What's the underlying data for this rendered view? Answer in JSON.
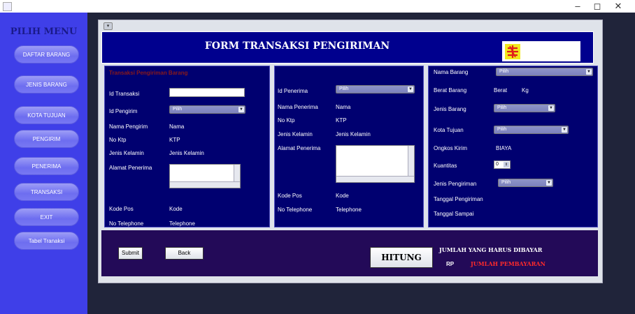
{
  "window": {
    "minimize": "–",
    "maximize": "◻",
    "close": "✕"
  },
  "sidebar": {
    "title": "PILIH MENU",
    "items": [
      {
        "label": "DAFTAR BARANG"
      },
      {
        "label": "JENIS BARANG"
      },
      {
        "label": "KOTA TUJUAN"
      },
      {
        "label": "PENGIRIM"
      },
      {
        "label": "PENERIMA"
      },
      {
        "label": "TRANSAKSI"
      },
      {
        "label": "EXIT"
      },
      {
        "label": "Tabel Tranaksi"
      }
    ]
  },
  "header": {
    "title": "FORM TRANSAKSI PENGIRIMAN"
  },
  "left_panel": {
    "title": "Transaksi Pengiriman Barang",
    "id_transaksi_label": "Id Transaksi",
    "id_transaksi_value": "",
    "id_pengirim_label": "Id Pengirim",
    "id_pengirim_value": "Pilih",
    "nama_pengirim_label": "Nama Pengirim",
    "nama_pengirim_value": "Nama",
    "no_ktp_label": "No Ktp",
    "no_ktp_value": "KTP",
    "jenis_kelamin_label": "Jenis Kelamin",
    "jenis_kelamin_value": "Jenis Kelamin",
    "alamat_label": "Alamat Penerima",
    "kode_pos_label": "Kode Pos",
    "kode_pos_value": "Kode",
    "telephone_label": "No Telephone",
    "telephone_value": "Telephone"
  },
  "mid_panel": {
    "id_penerima_label": "Id Penerima",
    "id_penerima_value": "Pilih",
    "nama_penerima_label": "Nama Penerima",
    "nama_penerima_value": "Nama",
    "no_ktp_label": "No Ktp",
    "no_ktp_value": "KTP",
    "jenis_kelamin_label": "Jenis Kelamin",
    "jenis_kelamin_value": "Jenis Kelamin",
    "alamat_label": "Alamat Penerima",
    "kode_pos_label": "Kode Pos",
    "kode_pos_value": "Kode",
    "telephone_label": "No Telephone",
    "telephone_value": "Telephone"
  },
  "right_panel": {
    "nama_barang_label": "Nama Barang",
    "nama_barang_value": "Pilih",
    "berat_label": "Berat Barang",
    "berat_value": "Berat",
    "berat_unit": "Kg",
    "jenis_barang_label": "Jenis Barang",
    "jenis_barang_value": "Pilih",
    "kota_tujuan_label": "Kota Tujuan",
    "kota_tujuan_value": "Pilih",
    "ongkos_label": "Ongkos Kirim",
    "ongkos_value": "BIAYA",
    "kuantitas_label": "Kuantitas",
    "kuantitas_value": "0",
    "jenis_pengiriman_label": "Jenis Pengiriman",
    "jenis_pengiriman_value": "Pilih",
    "tanggal_pengiriman_label": "Tanggal Pengiriman",
    "tanggal_sampai_label": "Tanggal Sampai"
  },
  "bottom": {
    "submit_label": "Submit",
    "back_label": "Back",
    "hitung_label": "HITUNG",
    "total_title": "JUMLAH YANG HARUS DIBAYAR",
    "currency": "RP",
    "total_value": "JUMLAH PEMBAYARAN"
  },
  "colors": {
    "sidebar": "#3f3fe8",
    "header": "#00008e",
    "panel": "#000070",
    "bottom_panel": "#230a58",
    "total_value": "#ff2a2a"
  }
}
